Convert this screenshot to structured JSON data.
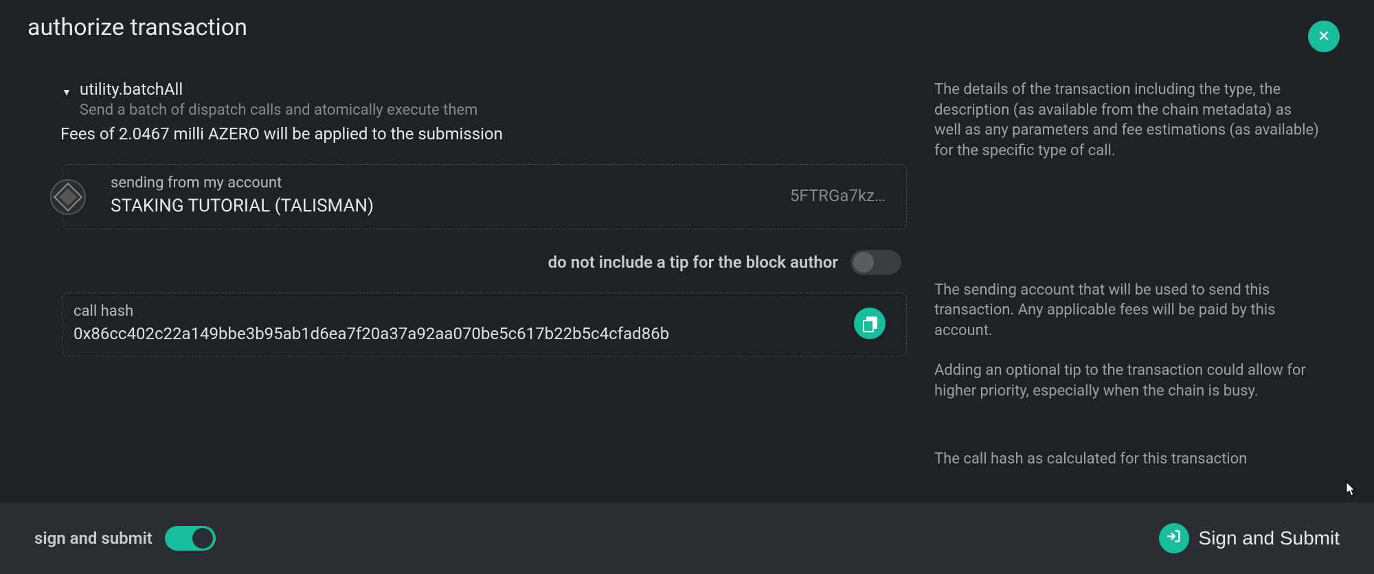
{
  "header": {
    "title": "authorize transaction"
  },
  "call": {
    "name": "utility.batchAll",
    "description": "Send a batch of dispatch calls and atomically execute them"
  },
  "fees": {
    "text": "Fees of 2.0467 milli AZERO will be applied to the submission"
  },
  "account": {
    "label": "sending from my account",
    "name": "STAKING TUTORIAL (TALISMAN)",
    "short": "5FTRGa7kz…"
  },
  "tip": {
    "label": "do not include a tip for the block author",
    "enabled": false
  },
  "hash": {
    "label": "call hash",
    "value": "0x86cc402c22a149bbe3b95ab1d6ea7f20a37a92aa070be5c617b22b5c4cfad86b"
  },
  "help": {
    "details": "The details of the transaction including the type, the description (as available from the chain metadata) as well as any parameters and fee estimations (as available) for the specific type of call.",
    "account": "The sending account that will be used to send this transaction. Any applicable fees will be paid by this account.",
    "tip": "Adding an optional tip to the transaction could allow for higher priority, especially when the chain is busy.",
    "hash": "The call hash as calculated for this transaction"
  },
  "footer": {
    "sign_label": "sign and submit",
    "sign_enabled": true,
    "submit_label": "Sign and Submit"
  }
}
